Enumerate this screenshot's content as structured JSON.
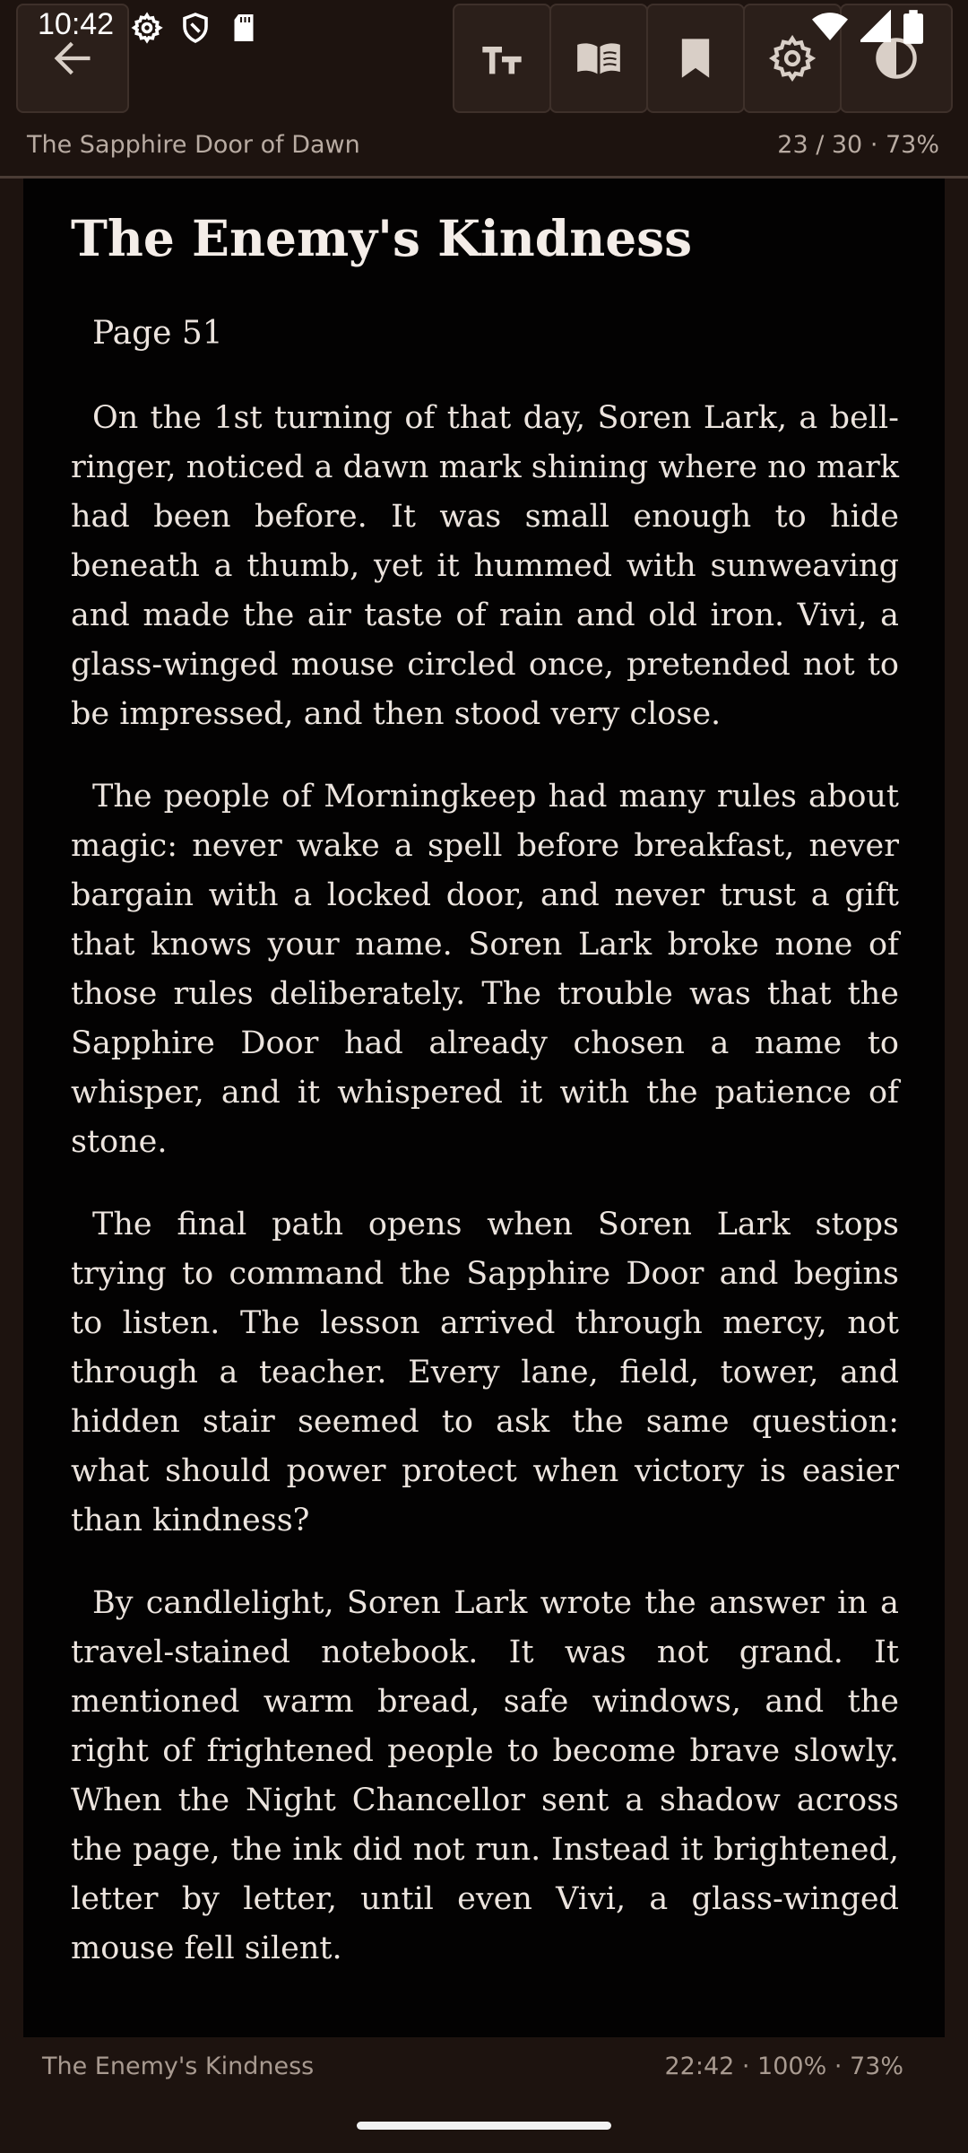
{
  "status_bar": {
    "time": "10:42"
  },
  "toolbar": {
    "buttons": [
      {
        "name": "back",
        "icon": "arrow-left-icon"
      },
      {
        "name": "text-size",
        "icon": "text-size-icon"
      },
      {
        "name": "table-of-contents",
        "icon": "open-book-icon"
      },
      {
        "name": "bookmark",
        "icon": "bookmark-icon"
      },
      {
        "name": "settings",
        "icon": "gear-icon"
      },
      {
        "name": "contrast",
        "icon": "contrast-icon"
      }
    ]
  },
  "book": {
    "title": "The Sapphire Door of Dawn",
    "progress": "23 / 30 · 73%"
  },
  "chapter": {
    "title": "The Enemy's Kindness",
    "page_label": "Page 51",
    "paragraphs": [
      "On the 1st turning of that day, Soren Lark, a bell-ringer, noticed a dawn mark shining where no mark had been before. It was small enough to hide beneath a thumb, yet it hummed with sunweaving and made the air taste of rain and old iron. Vivi, a glass-winged mouse circled once, pretended not to be impressed, and then stood very close.",
      "The people of Morningkeep had many rules about magic: never wake a spell before breakfast, never bargain with a locked door, and never trust a gift that knows your name. Soren Lark broke none of those rules deliberately. The trouble was that the Sapphire Door had already chosen a name to whisper, and it whispered it with the patience of stone.",
      "The final path opens when Soren Lark stops trying to command the Sapphire Door and begins to listen. The lesson arrived through mercy, not through a teacher. Every lane, field, tower, and hidden stair seemed to ask the same question: what should power protect when victory is easier than kindness?",
      "By candlelight, Soren Lark wrote the answer in a travel-stained notebook. It was not grand. It mentioned warm bread, safe windows, and the right of frightened people to become brave slowly. When the Night Chancellor sent a shadow across the page, the ink did not run. Instead it brightened, letter by letter, until even Vivi, a glass-winged mouse fell silent."
    ]
  },
  "footer": {
    "chapter_name": "The Enemy's Kindness",
    "status": "22:42 · 100% · 73%"
  },
  "colors": {
    "background": "#1d130f",
    "page": "#030202",
    "text": "#ece4de",
    "muted": "#a89a90"
  }
}
